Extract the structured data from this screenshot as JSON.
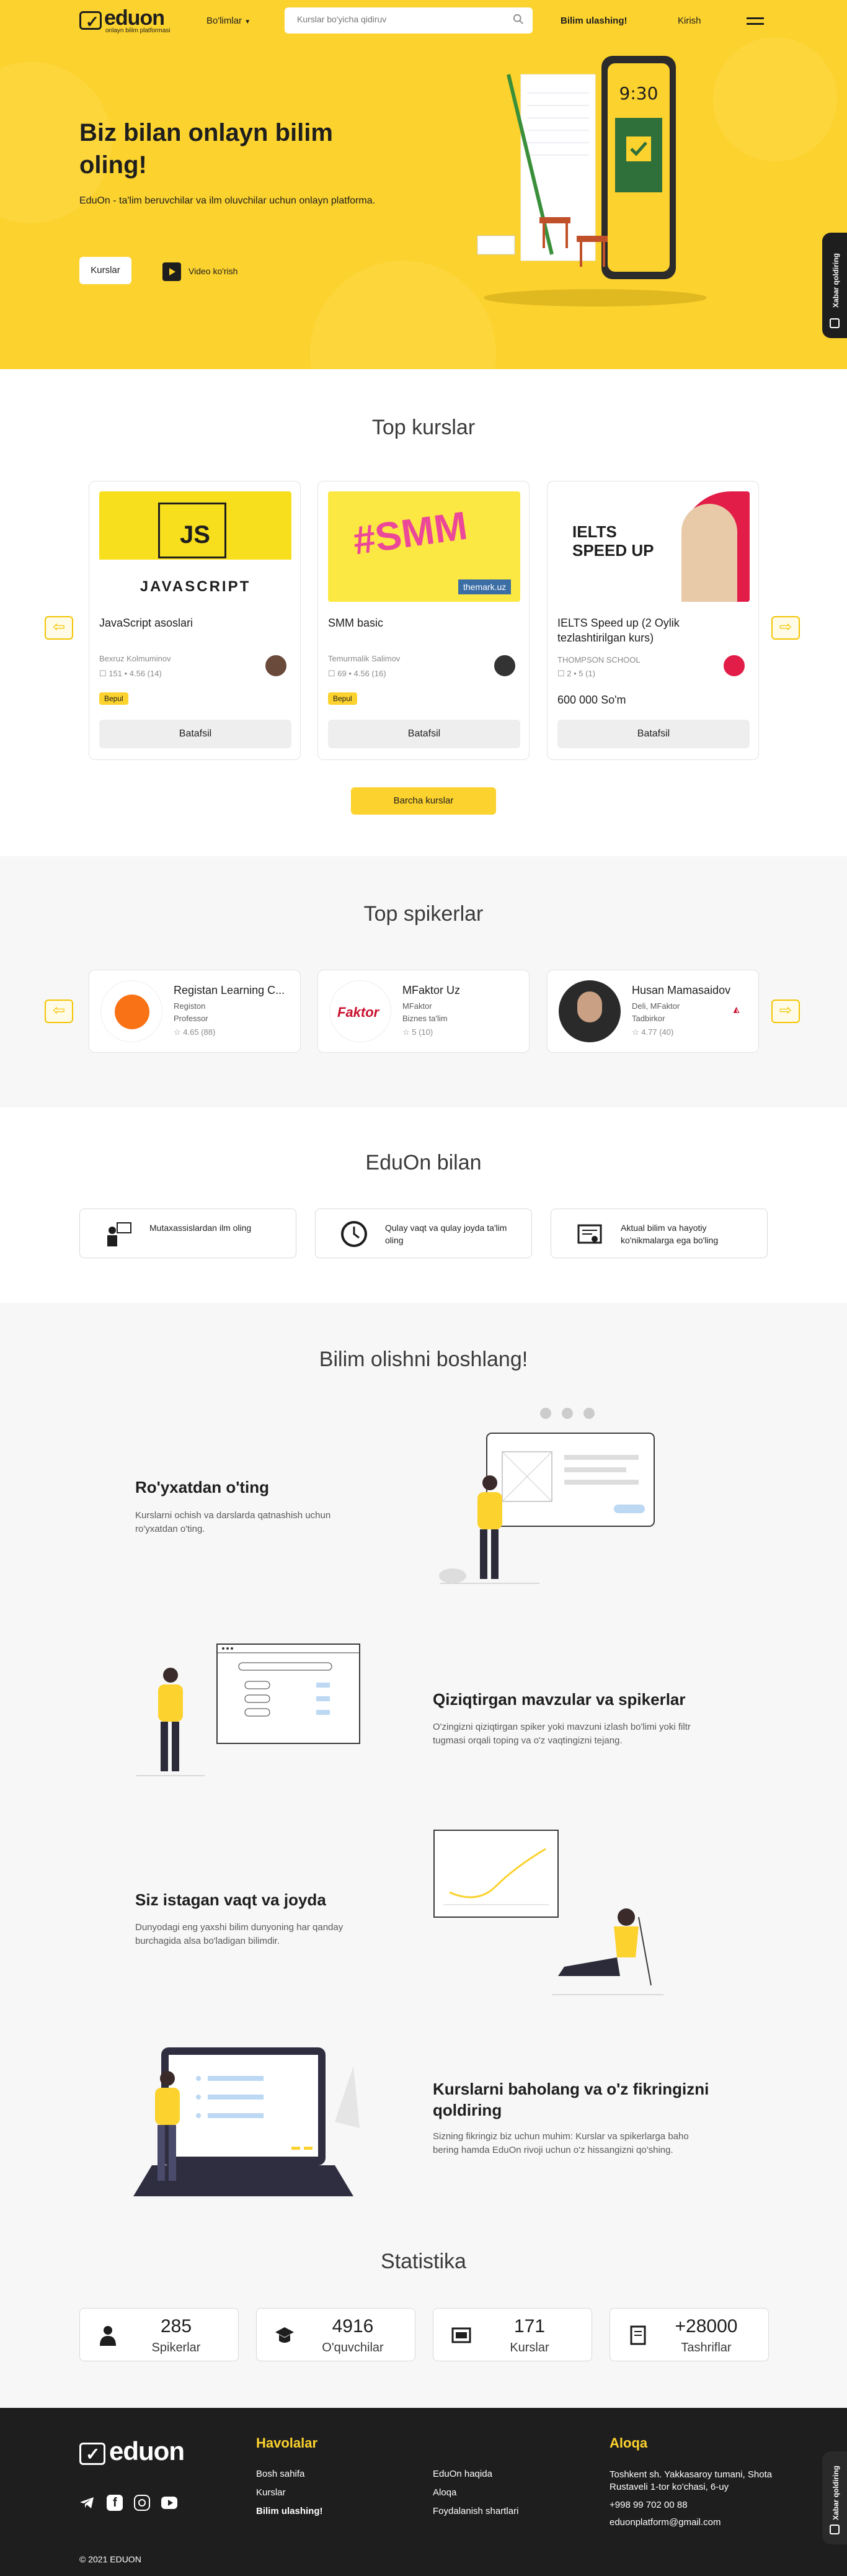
{
  "header": {
    "logo": "eduon",
    "logo_sub": "onlayn bilim platformasi",
    "categories": "Bo'limlar",
    "search_placeholder": "Kurslar bo'yicha qidiruv",
    "share": "Bilim ulashing!",
    "login": "Kirish"
  },
  "hero": {
    "title": "Biz bilan onlayn bilim oling!",
    "desc": "EduOn - ta'lim beruvchilar va ilm oluvchilar uchun onlayn platforma.",
    "courses_btn": "Kurslar",
    "video_btn": "Video ko'rish",
    "side_tab": "Xabar qoldiring"
  },
  "top_courses": {
    "title": "Top kurslar",
    "cards": [
      {
        "title": "JavaScript asoslari",
        "author": "Bexruz Kolmuminov",
        "meta": "151 • 4.56 (14)",
        "badge": "Bepul",
        "price": "",
        "button": "Batafsil",
        "img_word": "JAVASCRIPT",
        "img_tag": "JS"
      },
      {
        "title": "SMM basic",
        "author": "Temurmalik Salimov",
        "meta": "69 • 4.56 (16)",
        "badge": "Bepul",
        "price": "",
        "button": "Batafsil",
        "img_word": "themark.uz",
        "img_tag": "#SMM"
      },
      {
        "title": "IELTS Speed up (2 Oylik tezlashtirilgan kurs)",
        "author": "THOMPSON SCHOOL",
        "meta": "2 • 5 (1)",
        "badge": "",
        "price": "600 000 So'm",
        "button": "Batafsil",
        "img_word": "IELTS SPEED UP",
        "img_tag": ""
      }
    ],
    "all_btn": "Barcha kurslar"
  },
  "top_speakers": {
    "title": "Top spikerlar",
    "cards": [
      {
        "name": "Registan Learning C...",
        "company": "Registon",
        "role": "Professor",
        "rating": "4.65 (88)"
      },
      {
        "name": "MFaktor Uz",
        "company": "MFaktor",
        "role": "Biznes ta'lim",
        "rating": "5 (10)"
      },
      {
        "name": "Husan Mamasaidov",
        "company": "Deli, MFaktor",
        "role": "Tadbirkor",
        "rating": "4.77 (40)"
      }
    ],
    "mfaktor_logo": "Faktor"
  },
  "with_eduon": {
    "title": "EduOn bilan",
    "items": [
      {
        "text": "Mutaxassislardan ilm oling"
      },
      {
        "text": "Qulay vaqt va qulay joyda ta'lim oling"
      },
      {
        "text": "Aktual bilim va hayotiy ko'nikmalarga ega bo'ling"
      }
    ]
  },
  "start": {
    "title": "Bilim olishni boshlang!",
    "steps": [
      {
        "title": "Ro'yxatdan o'ting",
        "desc": "Kurslarni ochish va darslarda qatnashish uchun ro'yxatdan o'ting."
      },
      {
        "title": "Qiziqtirgan mavzular va spikerlar",
        "desc": "O'zingizni qiziqtirgan spiker yoki mavzuni izlash bo'limi yoki filtr tugmasi orqali toping va o'z vaqtingizni tejang."
      },
      {
        "title": "Siz istagan vaqt va joyda",
        "desc": "Dunyodagi eng yaxshi bilim dunyoning har qanday burchagida alsa bo'ladigan bilimdir."
      },
      {
        "title": "Kurslarni baholang va o'z fikringizni qoldiring",
        "desc": "Sizning fikringiz biz uchun muhim: Kurslar va spikerlarga baho bering hamda EduOn rivoji uchun o'z hissangizni qo'shing."
      }
    ]
  },
  "stats": {
    "title": "Statistika",
    "items": [
      {
        "num": "285",
        "label": "Spikerlar"
      },
      {
        "num": "4916",
        "label": "O'quvchilar"
      },
      {
        "num": "171",
        "label": "Kurslar"
      },
      {
        "num": "+28000",
        "label": "Tashriflar"
      }
    ]
  },
  "footer": {
    "logo": "eduon",
    "links_title": "Havolalar",
    "links_col1": [
      "Bosh sahifa",
      "Kurslar",
      "Bilim ulashing!"
    ],
    "links_col2": [
      "EduOn haqida",
      "Aloqa",
      "Foydalanish shartlari"
    ],
    "contact_title": "Aloqa",
    "address": "Toshkent sh. Yakkasaroy tumani, Shota Rustaveli 1-tor ko'chasi, 6-uy",
    "phone": "+998 99 702 00 88",
    "email": "eduonplatform@gmail.com",
    "copyright": "© 2021 EDUON",
    "side_tab": "Xabar qoldiring"
  },
  "colors": {
    "accent": "#fcd22e",
    "dark": "#1e1e1e",
    "light_bg": "#f7f7f7"
  }
}
